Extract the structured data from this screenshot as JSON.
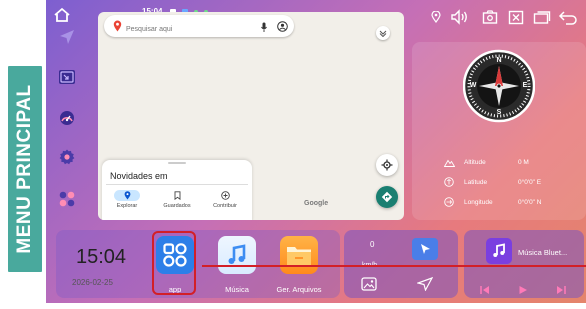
{
  "side_banner": {
    "label": "MENU PRINCIPAL"
  },
  "status_bar": {
    "time": "15:04"
  },
  "map": {
    "search_placeholder": "Pesquisar aqui",
    "novidades_title": "Novidades em",
    "tabs": [
      {
        "label": "Explorar"
      },
      {
        "label": "Guardados"
      },
      {
        "label": "Contribuir"
      }
    ],
    "google_label": "Google"
  },
  "compass": {
    "labels": {
      "north": "N",
      "south": "S",
      "east": "E",
      "west": "W"
    },
    "rows": [
      {
        "label": "Altitude",
        "value": "0 M"
      },
      {
        "label": "Latitude",
        "value": "0°0'0\" E"
      },
      {
        "label": "Longitude",
        "value": "0°0'0\" N"
      }
    ]
  },
  "clock": {
    "time": "15:04",
    "date": "2026-02-25"
  },
  "apps": [
    {
      "label": "app"
    },
    {
      "label": "Música"
    },
    {
      "label": "Ger. Arquivos"
    }
  ],
  "speed": {
    "value": "0",
    "unit": "km/h"
  },
  "music": {
    "title": "Música Bluet..."
  },
  "colors": {
    "highlight_red": "#d31f27",
    "banner_teal": "#49a99d",
    "app_blue": "#2d7fe8",
    "nav_blue": "#4a7ee8"
  }
}
